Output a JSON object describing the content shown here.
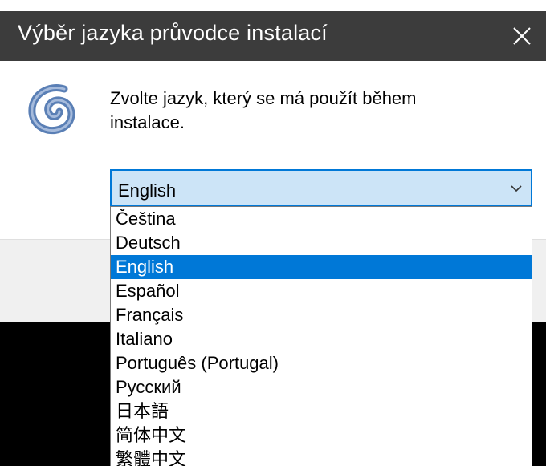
{
  "dialog": {
    "title": "Výběr jazyka průvodce instalací",
    "prompt": "Zvolte jazyk, který se má použít během instalace."
  },
  "language_select": {
    "value": "English",
    "options": [
      "Čeština",
      "Deutsch",
      "English",
      "Español",
      "Français",
      "Italiano",
      "Português (Portugal)",
      "Русский",
      "日本語",
      "简体中文",
      "繁體中文"
    ],
    "selected_index": 2
  },
  "colors": {
    "accent": "#0078d7",
    "title_bar": "#3c3c3c",
    "combo_fill": "#cce4f7"
  },
  "icons": {
    "logo": "swirl-logo-icon",
    "close": "close-icon",
    "chevron": "chevron-down-icon"
  }
}
